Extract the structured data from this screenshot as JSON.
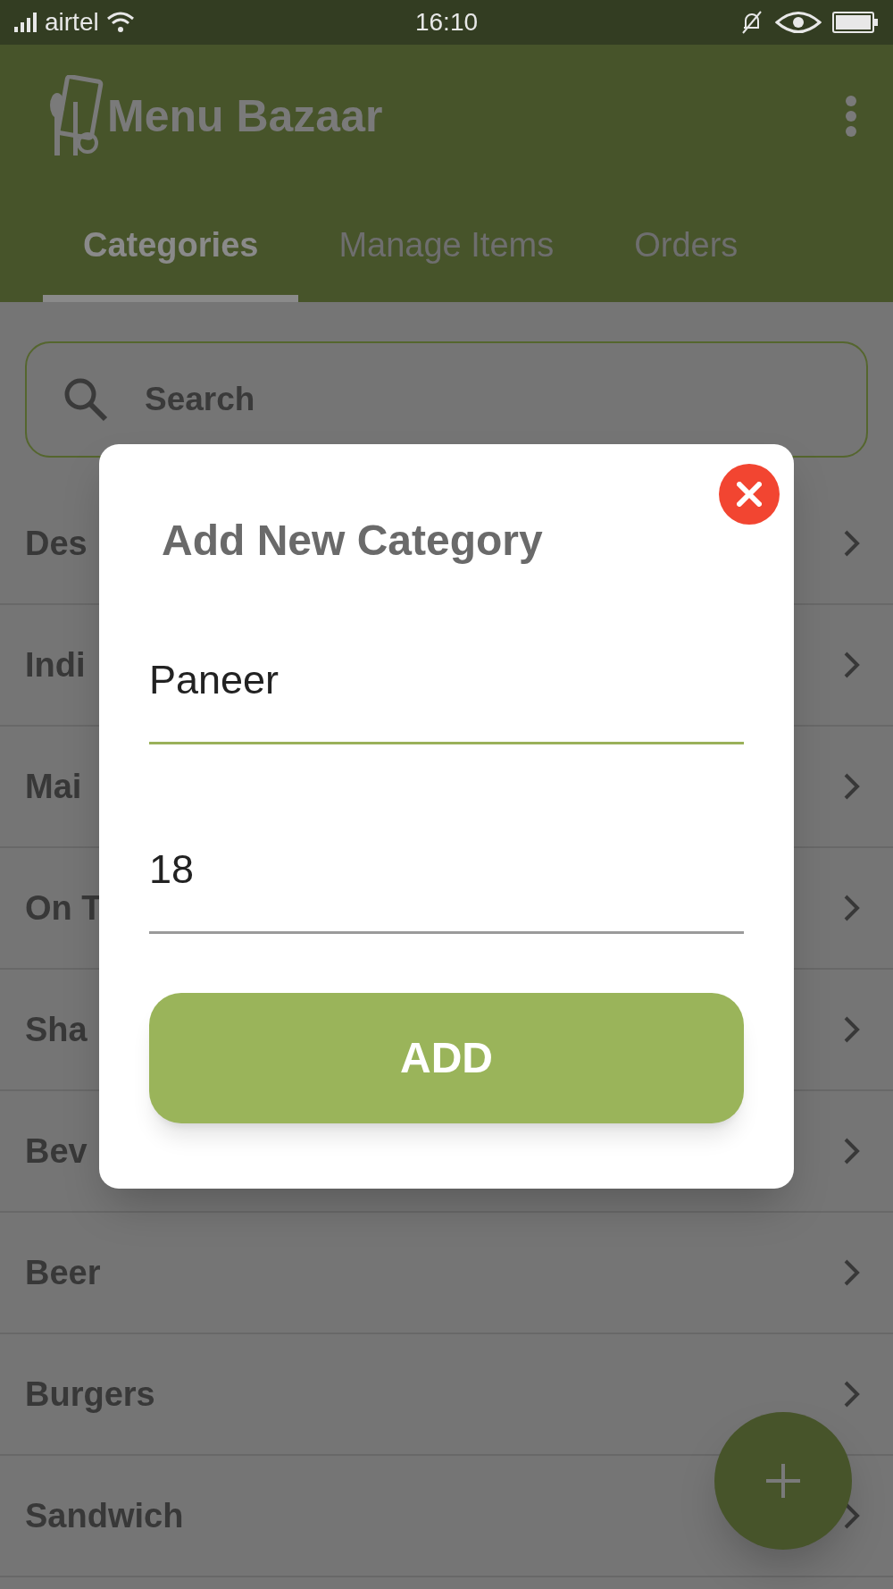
{
  "status_bar": {
    "carrier": "airtel",
    "time": "16:10"
  },
  "app_bar": {
    "title": "Menu Bazaar"
  },
  "tabs": [
    {
      "label": "Categories",
      "selected": true
    },
    {
      "label": "Manage Items",
      "selected": false
    },
    {
      "label": "Orders",
      "selected": false
    }
  ],
  "search": {
    "placeholder": "Search"
  },
  "categories": [
    {
      "name": "Des"
    },
    {
      "name": "Indi"
    },
    {
      "name": "Mai"
    },
    {
      "name": "On T"
    },
    {
      "name": "Sha"
    },
    {
      "name": "Bev"
    },
    {
      "name": "Beer"
    },
    {
      "name": "Burgers"
    },
    {
      "name": "Sandwich"
    }
  ],
  "dialog": {
    "title": "Add New Category",
    "fields": [
      {
        "value": "Paneer",
        "focused": true
      },
      {
        "value": "18",
        "focused": false
      }
    ],
    "button": "ADD"
  }
}
